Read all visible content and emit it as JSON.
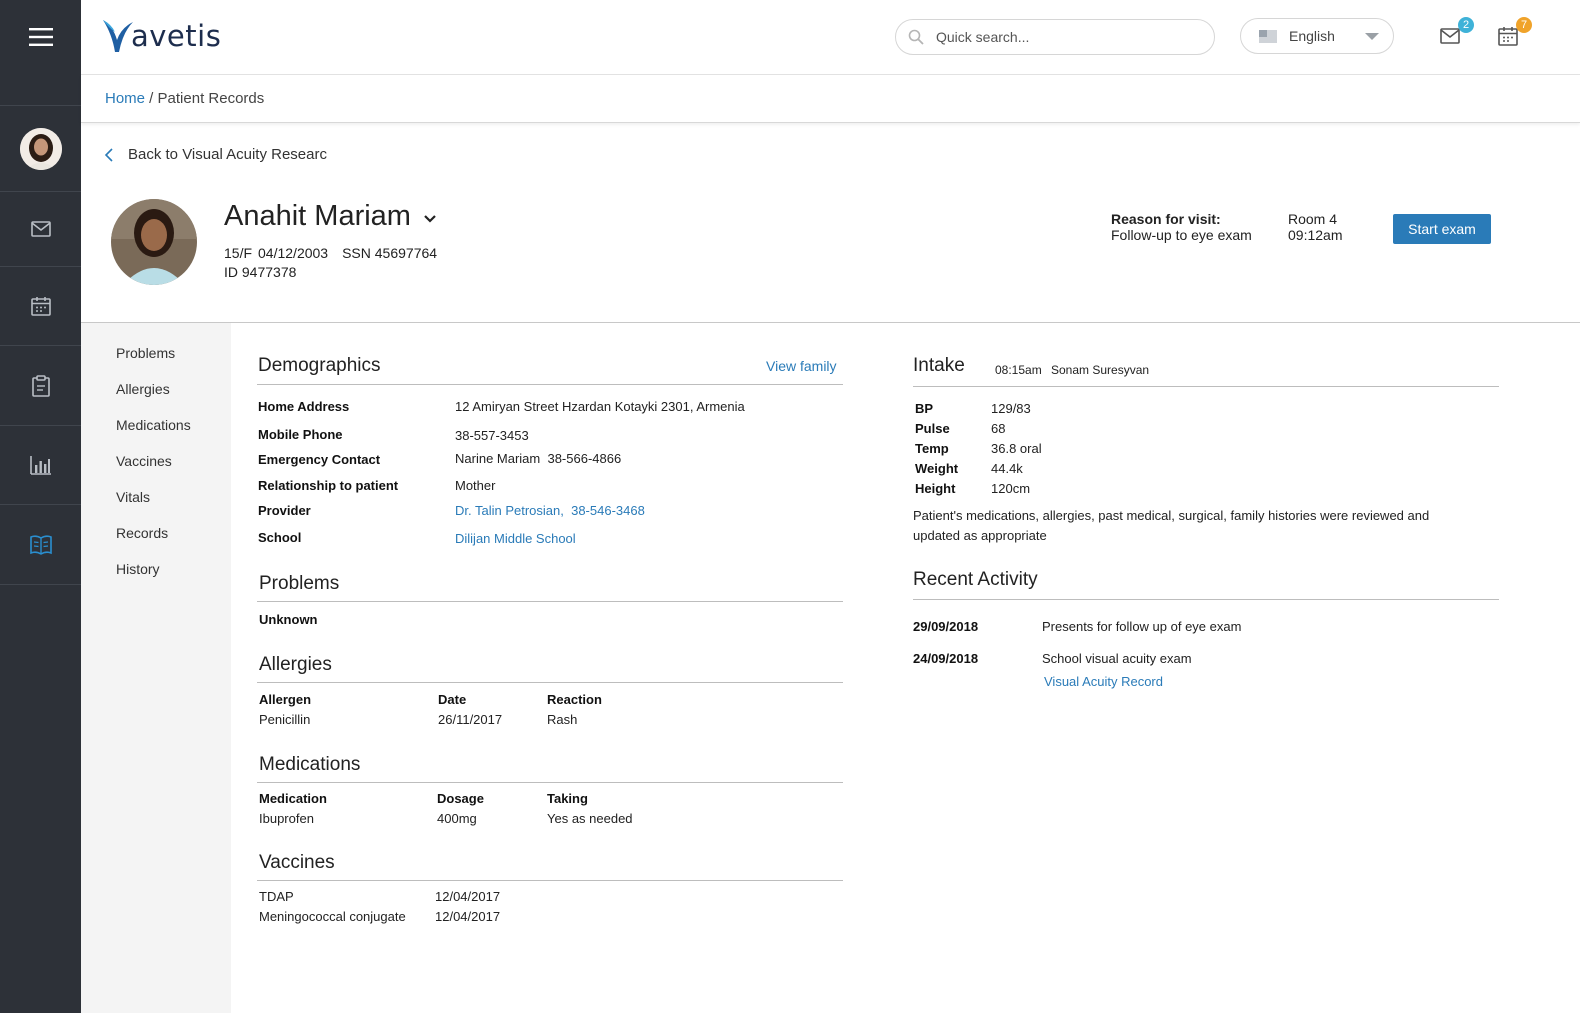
{
  "app": {
    "logo_text": "avetis",
    "accent": "#2a7bb8",
    "rail_bg": "#2d3138"
  },
  "rail": {
    "items": [
      "menu-icon",
      "mail-icon",
      "calendar-icon",
      "clipboard-icon",
      "bar-chart-icon",
      "book-icon"
    ]
  },
  "header": {
    "search_placeholder": "Quick search...",
    "language": "English",
    "mail_badge": "2",
    "calendar_badge": "7",
    "mail_badge_color": "#3fb2d8",
    "calendar_badge_color": "#f0a32a"
  },
  "breadcrumb": {
    "home": "Home",
    "separator": " / ",
    "current": "Patient Records"
  },
  "back_link": "Back to Visual Acuity Researc",
  "patient": {
    "name": "Anahit Mariam",
    "age_sex": "15/F",
    "dob": "04/12/2003",
    "ssn": "SSN 45697764",
    "id": "ID 9477378"
  },
  "visit": {
    "reason_label": "Reason for visit:",
    "reason": "Follow-up to eye exam",
    "room": "Room 4",
    "time": "09:12am",
    "start_button": "Start exam"
  },
  "leftnav": [
    "Problems",
    "Allergies",
    "Medications",
    "Vaccines",
    "Vitals",
    "Records",
    "History"
  ],
  "demographics": {
    "title": "Demographics",
    "view_family": "View family",
    "rows": [
      {
        "label": "Home Address",
        "value": "12 Amiryan Street Hzardan Kotayki 2301, Armenia"
      },
      {
        "label": "Mobile Phone",
        "value": "38-557-3453"
      },
      {
        "label": "Emergency Contact",
        "value": "Narine Mariam  38-566-4866"
      },
      {
        "label": "Relationship to patient",
        "value": "Mother"
      },
      {
        "label": "Provider",
        "value": "Dr. Talin Petrosian,  38-546-3468"
      },
      {
        "label": "School",
        "value": "Dilijan Middle School"
      }
    ]
  },
  "problems": {
    "title": "Problems",
    "items": [
      "Unknown"
    ]
  },
  "allergies": {
    "title": "Allergies",
    "headers": [
      "Allergen",
      "Date",
      "Reaction"
    ],
    "rows": [
      [
        "Penicillin",
        "26/11/2017",
        "Rash"
      ]
    ]
  },
  "medications": {
    "title": "Medications",
    "headers": [
      "Medication",
      "Dosage",
      "Taking"
    ],
    "rows": [
      [
        "Ibuprofen",
        "400mg",
        "Yes as needed"
      ]
    ]
  },
  "vaccines": {
    "title": "Vaccines",
    "rows": [
      [
        "TDAP",
        "12/04/2017"
      ],
      [
        "Meningococcal conjugate",
        "12/04/2017"
      ]
    ]
  },
  "intake": {
    "title": "Intake",
    "time": "08:15am",
    "nurse": "Sonam Suresyvan",
    "vitals": [
      {
        "label": "BP",
        "value": "129/83"
      },
      {
        "label": "Pulse",
        "value": "68"
      },
      {
        "label": "Temp",
        "value": "36.8 oral"
      },
      {
        "label": "Weight",
        "value": "44.4k"
      },
      {
        "label": "Height",
        "value": "120cm"
      }
    ],
    "note": "Patient's medications, allergies, past medical, surgical, family histories were reviewed and updated as appropriate"
  },
  "recent_activity": {
    "title": "Recent Activity",
    "items": [
      {
        "date": "29/09/2018",
        "text": "Presents for follow up of eye exam"
      },
      {
        "date": "24/09/2018",
        "text": "School visual acuity exam",
        "link": "Visual Acuity Record"
      }
    ]
  }
}
